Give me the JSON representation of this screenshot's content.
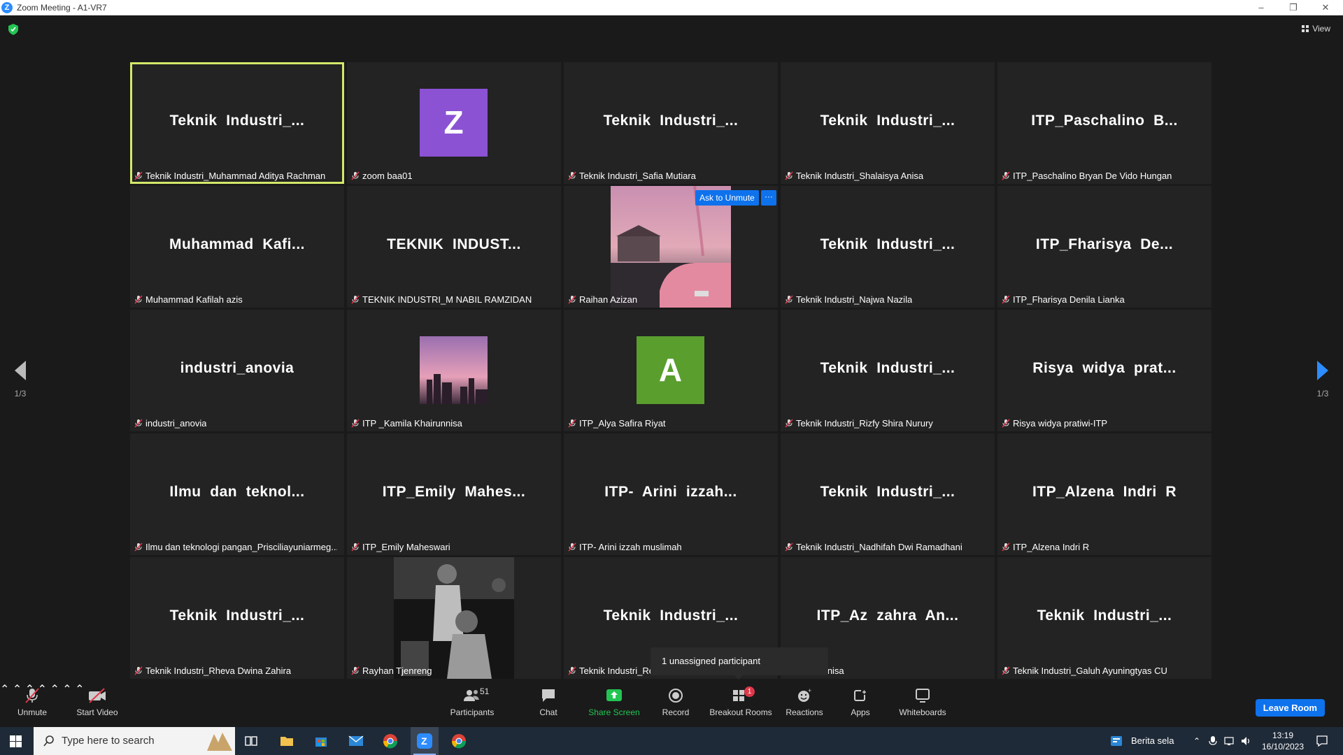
{
  "window": {
    "title": "Zoom Meeting - A1-VR7",
    "logo_letter": "Z"
  },
  "view_button": {
    "label": "View"
  },
  "tiles": [
    {
      "big": "Teknik  Industri_...",
      "caption": "Teknik Industri_Muhammad Aditya Rachman"
    },
    {
      "big": "",
      "caption": "zoom baa01",
      "avatar": "Z",
      "avatar_color": "#8b52d4"
    },
    {
      "big": "Teknik  Industri_...",
      "caption": "Teknik Industri_Safia Mutiara"
    },
    {
      "big": "Teknik  Industri_...",
      "caption": "Teknik Industri_Shalaisya Anisa"
    },
    {
      "big": "ITP_Paschalino  B...",
      "caption": "ITP_Paschalino Bryan De Vido Hungan"
    },
    {
      "big": "Muhammad  Kafi...",
      "caption": "Muhammad Kafilah azis"
    },
    {
      "big": "TEKNIK  INDUST...",
      "caption": "TEKNIK INDUSTRI_M NABIL RAMZIDAN"
    },
    {
      "big": "",
      "caption": "Raihan Azizan",
      "photo": "car"
    },
    {
      "big": "Teknik  Industri_...",
      "caption": "Teknik Industri_Najwa Nazila"
    },
    {
      "big": "ITP_Fharisya  De...",
      "caption": "ITP_Fharisya Denila Lianka"
    },
    {
      "big": "industri_anovia",
      "caption": "industri_anovia"
    },
    {
      "big": "",
      "caption": "ITP _Kamila Khairunnisa",
      "photo": "sunset"
    },
    {
      "big": "",
      "caption": "ITP_Alya Safira Riyat",
      "avatar": "A",
      "avatar_color": "#5a9e2e"
    },
    {
      "big": "Teknik  Industri_...",
      "caption": "Teknik Industri_Rizfy Shira Nurury"
    },
    {
      "big": "Risya  widya  prat...",
      "caption": "Risya widya pratiwi-ITP"
    },
    {
      "big": "Ilmu  dan  teknol...",
      "caption": "Ilmu dan teknologi pangan_Prisciliayuniarmeg..."
    },
    {
      "big": "ITP_Emily  Mahes...",
      "caption": "ITP_Emily Maheswari"
    },
    {
      "big": "ITP-  Arini  izzah...",
      "caption": "ITP- Arini izzah muslimah"
    },
    {
      "big": "Teknik  Industri_...",
      "caption": "Teknik Industri_Nadhifah Dwi Ramadhani"
    },
    {
      "big": "ITP_Alzena  Indri  R",
      "caption": "ITP_Alzena Indri R"
    },
    {
      "big": "Teknik  Industri_...",
      "caption": "Teknik Industri_Rheva Dwina Zahira"
    },
    {
      "big": "",
      "caption": "Rayhan Tjenreng",
      "photo": "bw"
    },
    {
      "big": "Teknik  Industri_...",
      "caption": "Teknik Industri_Re"
    },
    {
      "big": "ITP_Az  zahra  An...",
      "caption": "ahra Annisa"
    },
    {
      "big": "Teknik  Industri_...",
      "caption": "Teknik Industri_Galuh Ayuningtyas CU"
    }
  ],
  "hover": {
    "ask_unmute": "Ask to Unmute",
    "more": "···"
  },
  "pager": {
    "left": "1/3",
    "right": "1/3"
  },
  "tooltip": "1 unassigned participant",
  "toolbar": {
    "unmute": "Unmute",
    "start_video": "Start Video",
    "participants": "Participants",
    "participants_count": "51",
    "chat": "Chat",
    "share_screen": "Share Screen",
    "record": "Record",
    "breakout_rooms": "Breakout Rooms",
    "breakout_badge": "1",
    "reactions": "Reactions",
    "apps": "Apps",
    "whiteboards": "Whiteboards",
    "leave": "Leave Room"
  },
  "taskbar": {
    "search_placeholder": "Type here to search",
    "news": "Berita sela",
    "time": "13:19",
    "date": "16/10/2023"
  },
  "colors": {
    "accent": "#0e72ed",
    "active_speaker": "#d4e86a",
    "share_green": "#23c552"
  }
}
